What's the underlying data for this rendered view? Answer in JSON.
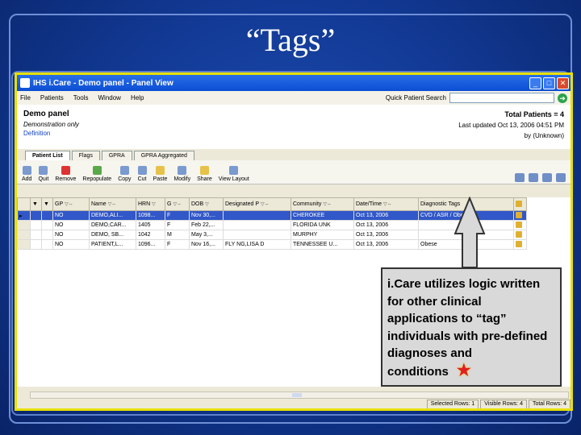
{
  "slide": {
    "title": "“Tags”"
  },
  "window": {
    "title": "IHS i.Care - Demo panel - Panel View",
    "minimize": "_",
    "maximize": "□",
    "close": "✕"
  },
  "menu": {
    "items": [
      "File",
      "Patients",
      "Tools",
      "Window",
      "Help"
    ],
    "quick_search_label": "Quick Patient Search",
    "quick_search_value": "",
    "go_label": "➜"
  },
  "panel": {
    "name": "Demo panel",
    "subtitle": "Demonstration only",
    "definition_link": "Definition",
    "total_patients": "Total Patients = 4",
    "last_updated": "Last updated Oct 13, 2006 04:51 PM",
    "by": "by (Unknown)"
  },
  "tabs": [
    "Patient List",
    "Flags",
    "GPRA",
    "GPRA Aggregated"
  ],
  "toolbar": [
    "Add",
    "Quit",
    "Remove",
    "Repopulate",
    "Copy",
    "Cut",
    "Paste",
    "Modify",
    "Share",
    "View Layout"
  ],
  "grid": {
    "columns": [
      "GP",
      "Name",
      "HRN",
      "G",
      "DOB",
      "Designated P",
      "Community",
      "Date/Time",
      "Diagnostic Tags"
    ],
    "rows": [
      [
        "NO",
        "DEMO,ALI...",
        "1098...",
        "F",
        "Nov 30,...",
        "",
        "CHEROKEE",
        "Oct 13, 2006",
        "CVD / ASR / Obese"
      ],
      [
        "NO",
        "DEMO,CAR...",
        "1405",
        "F",
        "Feb 22,...",
        "",
        "FLORIDA UNK",
        "Oct 13, 2006",
        ""
      ],
      [
        "NO",
        "DEMO, SB...",
        "1042",
        "M",
        "May 3,...",
        "",
        "MURPHY",
        "Oct 13, 2006",
        ""
      ],
      [
        "NO",
        "PATIENT,L...",
        "1096...",
        "F",
        "Nov 16,...",
        "FLY NG,LISA D",
        "TENNESSEE U...",
        "Oct 13, 2006",
        "Obese"
      ]
    ]
  },
  "status": [
    "Selected Rows: 1",
    "Visible Rows: 4",
    "Total Rows: 4"
  ],
  "callout": {
    "text": "i.Care utilizes logic written for other clinical applications to “tag” individuals with pre-defined diagnoses and conditions",
    "star": "★"
  }
}
